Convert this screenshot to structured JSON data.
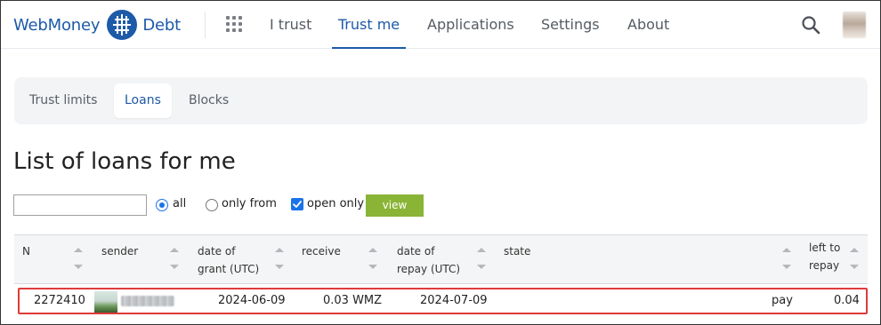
{
  "header": {
    "brand_left": "WebMoney",
    "brand_right": "Debt",
    "nav": [
      "I trust",
      "Trust me",
      "Applications",
      "Settings",
      "About"
    ],
    "active_nav": "Trust me"
  },
  "subtabs": [
    "Trust limits",
    "Loans",
    "Blocks"
  ],
  "active_subtab": "Loans",
  "title": "List of loans for me",
  "filter": {
    "input_value": "",
    "options": [
      "all",
      "only from"
    ],
    "selected_option": "all",
    "open_only_label": "open only",
    "open_only_checked": true,
    "view_button": "view"
  },
  "table": {
    "columns": [
      "N",
      "sender",
      "date of grant (UTC)",
      "receive",
      "date of repay (UTC)",
      "state",
      "left to repay"
    ],
    "col_lines": {
      "grant_1": "date of",
      "grant_2": "grant (UTC)",
      "repay_1": "date of",
      "repay_2": "repay (UTC)",
      "left_1": "left to",
      "left_2": "repay"
    },
    "rows": [
      {
        "n": "2272410",
        "date_grant": "2024-06-09",
        "receive": "0.03 WMZ",
        "date_repay": "2024-07-09",
        "state": "pay",
        "left_to_repay": "0.04"
      }
    ]
  },
  "colors": {
    "brand": "#1d5aa8",
    "view_button": "#8ab436",
    "highlight": "#e03a3a",
    "accent": "#1a73e8"
  }
}
